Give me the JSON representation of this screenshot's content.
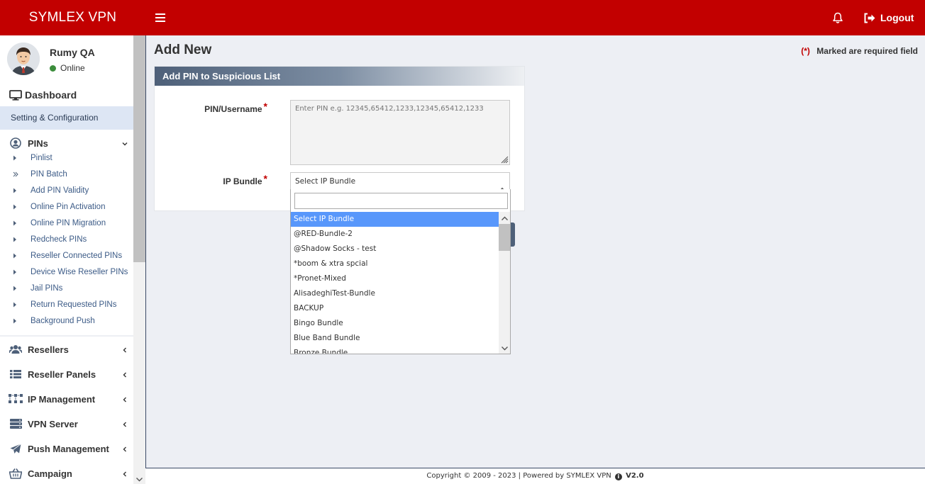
{
  "header": {
    "brand": "SYMLEX VPN",
    "logout_label": "Logout",
    "menu_icon": "hamburger-icon",
    "notification_icon": "bell-icon",
    "logout_icon": "sign-out-icon",
    "accent_color": "#c20000"
  },
  "user": {
    "name": "Rumy QA",
    "status": "Online",
    "status_color": "#3c8d3c"
  },
  "sidebar": {
    "dashboard": "Dashboard",
    "section_label": "Setting & Configuration",
    "pins": {
      "label": "PINs",
      "items": [
        "Pinlist",
        "PIN Batch",
        "Add PIN Validity",
        "Online Pin Activation",
        "Online PIN Migration",
        "Redcheck PINs",
        "Reseller Connected PINs",
        "Device Wise Reseller PINs",
        "Jail PINs",
        "Return Requested PINs",
        "Background Push"
      ]
    },
    "groups": [
      "Resellers",
      "Reseller Panels",
      "IP Management",
      "VPN Server",
      "Push Management",
      "Campaign"
    ]
  },
  "main": {
    "title": "Add New",
    "required_mark": "(*)",
    "required_note": "Marked are required field",
    "panel_title": "Add PIN to Suspicious List",
    "pin_label": "PIN/Username",
    "pin_placeholder": "Enter PIN e.g. 12345,65412,1233,12345,65412,1233",
    "ip_bundle_label": "IP Bundle",
    "ip_bundle_selected": "Select IP Bundle",
    "ip_bundle_search_value": "",
    "ip_bundle_options": [
      "Select IP Bundle",
      "@RED-Bundle-2",
      "@Shadow Socks - test",
      "*boom & xtra spcial",
      "*Pronet-Mixed",
      "AlisadeghiTest-Bundle",
      "BACKUP",
      "Bingo Bundle",
      "Blue Band Bundle",
      "Bronze Bundle"
    ]
  },
  "footer": {
    "copyright": "Copyright © 2009 - 2023 | Powered by SYMLEX VPN",
    "version": "V2.0"
  }
}
